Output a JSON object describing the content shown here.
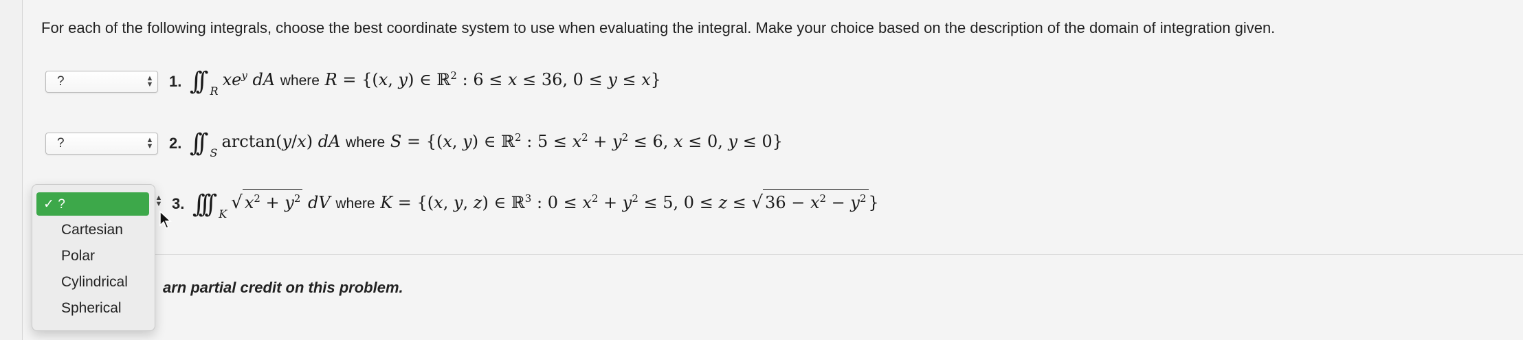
{
  "instructions": "For each of the following integrals, choose the best coordinate system to use when evaluating the integral. Make your choice based on the description of the domain of integration given.",
  "questions": [
    {
      "number": "1.",
      "selected": "?"
    },
    {
      "number": "2.",
      "selected": "?"
    },
    {
      "number": "3.",
      "selected": "?"
    }
  ],
  "math": {
    "q1": {
      "where": "where"
    },
    "q2": {
      "where": "where"
    },
    "q3": {
      "where": "where"
    }
  },
  "dropdown": {
    "selected_label": "✓ ?",
    "options": [
      "Cartesian",
      "Polar",
      "Cylindrical",
      "Spherical"
    ]
  },
  "footer": {
    "partial_credit": "arn partial credit on this problem."
  },
  "colors": {
    "selected_option_bg": "#3da84a",
    "background": "#f4f4f4"
  }
}
